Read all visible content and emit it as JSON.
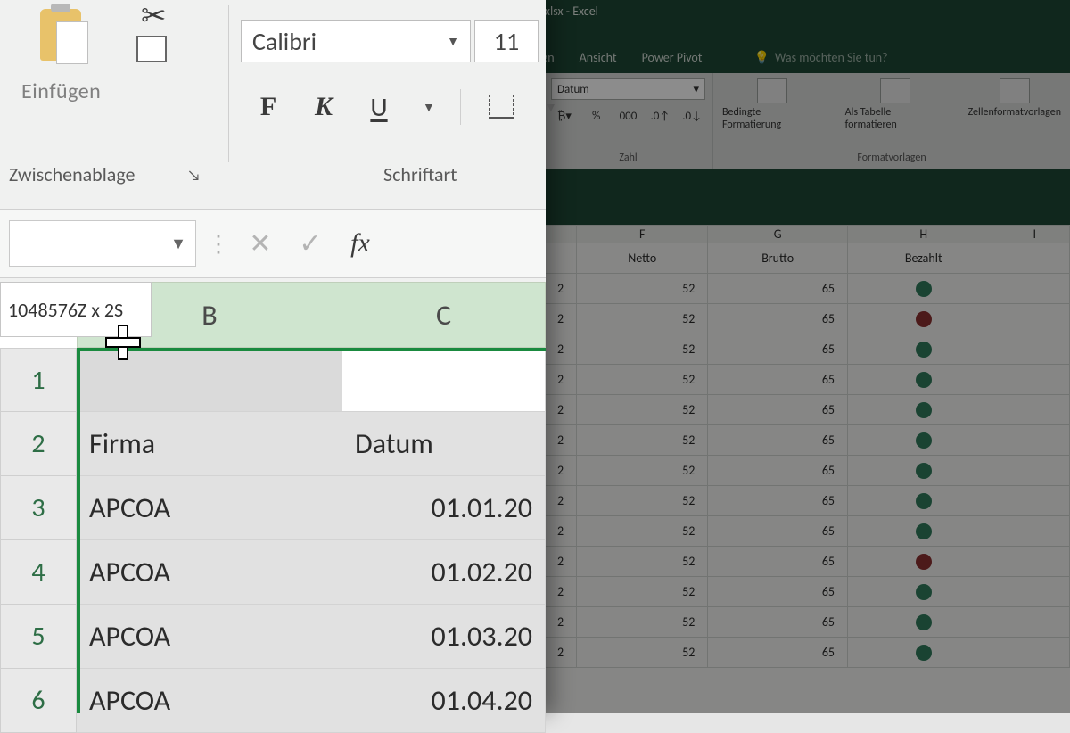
{
  "app": {
    "title": "Buchungsliste.xlsx - Excel"
  },
  "bg_tabs": {
    "t0": "üfen",
    "t1": "Ansicht",
    "t2": "Power Pivot",
    "tell": "Was möchten Sie tun?"
  },
  "bg_ribbon": {
    "numfmt_value": "Datum",
    "btn_currency": "%",
    "btn_thousand": "000",
    "btn_inc": ".00→.0",
    "btn_dec": ".0→.00",
    "grp_number": "Zahl",
    "sty_cond": "Bedingte Formatierung",
    "sty_table": "Als Tabelle formatieren",
    "sty_cell": "Zellenformatvorlagen",
    "grp_styles": "Formatvorlagen"
  },
  "bg_grid": {
    "col_f": "F",
    "col_g": "G",
    "col_h": "H",
    "col_i": "I",
    "hdr_f": "Netto",
    "hdr_g": "Brutto",
    "hdr_h": "Bezahlt",
    "rows": [
      {
        "e": "2",
        "f": "52",
        "g": "65",
        "dot": "green"
      },
      {
        "e": "2",
        "f": "52",
        "g": "65",
        "dot": "red"
      },
      {
        "e": "2",
        "f": "52",
        "g": "65",
        "dot": "green"
      },
      {
        "e": "2",
        "f": "52",
        "g": "65",
        "dot": "green"
      },
      {
        "e": "2",
        "f": "52",
        "g": "65",
        "dot": "green"
      },
      {
        "e": "2",
        "f": "52",
        "g": "65",
        "dot": "green"
      },
      {
        "e": "2",
        "f": "52",
        "g": "65",
        "dot": "green"
      },
      {
        "e": "2",
        "f": "52",
        "g": "65",
        "dot": "green"
      },
      {
        "e": "2",
        "f": "52",
        "g": "65",
        "dot": "green"
      },
      {
        "e": "2",
        "f": "52",
        "g": "65",
        "dot": "red"
      },
      {
        "e": "2",
        "f": "52",
        "g": "65",
        "dot": "green"
      },
      {
        "e": "2",
        "f": "52",
        "g": "65",
        "dot": "green"
      },
      {
        "e": "2",
        "f": "52",
        "g": "65",
        "dot": "green"
      }
    ]
  },
  "fg_ribbon": {
    "paste": "Einfügen",
    "grp_clip": "Zwischenablage",
    "font_name": "Calibri",
    "font_size": "11",
    "bold": "F",
    "italic": "K",
    "under": "U",
    "grp_font": "Schriftart"
  },
  "fbar": {
    "fx": "fx",
    "cancel": "✕",
    "confirm": "✓"
  },
  "sheet": {
    "size_label": "1048576Z x 2S",
    "col_b": "B",
    "col_c": "C",
    "row_1": "1",
    "row_2": "2",
    "row_3": "3",
    "row_4": "4",
    "row_5": "5",
    "row_6": "6",
    "b2": "Firma",
    "c2": "Datum",
    "b3": "APCOA",
    "c3": "01.01.20",
    "b4": "APCOA",
    "c4": "01.02.20",
    "b5": "APCOA",
    "c5": "01.03.20",
    "b6": "APCOA",
    "c6": "01.04.20"
  }
}
